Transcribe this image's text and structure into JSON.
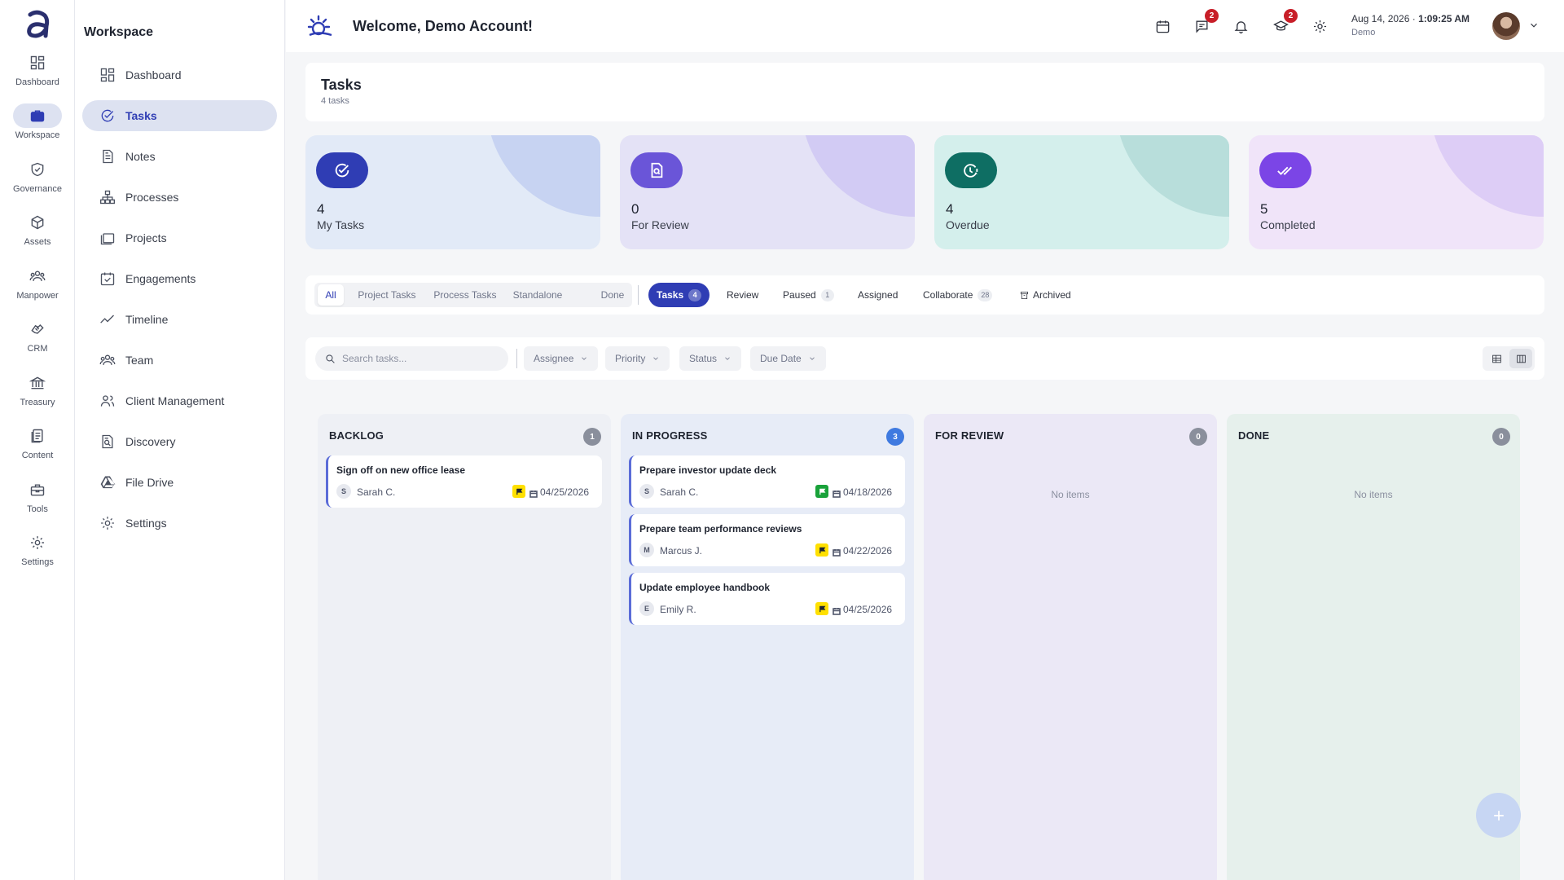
{
  "rail": {
    "items": [
      {
        "label": "Dashboard",
        "icon": "dashboard-icon"
      },
      {
        "label": "Workspace",
        "icon": "briefcase-icon",
        "active": true
      },
      {
        "label": "Governance",
        "icon": "shield-check-icon"
      },
      {
        "label": "Assets",
        "icon": "cube-icon"
      },
      {
        "label": "Manpower",
        "icon": "people-icon"
      },
      {
        "label": "CRM",
        "icon": "handshake-icon"
      },
      {
        "label": "Treasury",
        "icon": "bank-icon"
      },
      {
        "label": "Content",
        "icon": "document-icon"
      },
      {
        "label": "Tools",
        "icon": "toolbox-icon"
      },
      {
        "label": "Settings",
        "icon": "gear-icon"
      }
    ]
  },
  "sidebar": {
    "title": "Workspace",
    "items": [
      {
        "label": "Dashboard",
        "icon": "dashboard-icon"
      },
      {
        "label": "Tasks",
        "icon": "check-circle-icon",
        "active": true
      },
      {
        "label": "Notes",
        "icon": "note-icon"
      },
      {
        "label": "Processes",
        "icon": "hierarchy-icon"
      },
      {
        "label": "Projects",
        "icon": "folders-icon"
      },
      {
        "label": "Engagements",
        "icon": "calendar-check-icon"
      },
      {
        "label": "Timeline",
        "icon": "trend-line-icon"
      },
      {
        "label": "Team",
        "icon": "team-icon"
      },
      {
        "label": "Client Management",
        "icon": "client-icon"
      },
      {
        "label": "Discovery",
        "icon": "search-document-icon"
      },
      {
        "label": "File Drive",
        "icon": "drive-icon"
      },
      {
        "label": "Settings",
        "icon": "gear-icon"
      }
    ]
  },
  "header": {
    "welcome": "Welcome, Demo Account!",
    "date": "Aug 14, 2026",
    "time": "1:09:25 AM",
    "user": "Demo",
    "chat_badge": "2",
    "school_badge": "2"
  },
  "page": {
    "title": "Tasks",
    "subtitle": "4 tasks"
  },
  "stats": [
    {
      "value": "4",
      "label": "My Tasks",
      "bg": "#e2eaf7",
      "blob": "#c7d3f2",
      "icon_bg": "#2f3db4"
    },
    {
      "value": "0",
      "label": "For Review",
      "bg": "#e4e2f6",
      "blob": "#d2cbf4",
      "icon_bg": "#6a55d8"
    },
    {
      "value": "4",
      "label": "Overdue",
      "bg": "#d4efec",
      "blob": "#b8dedb",
      "icon_bg": "#0e6e63"
    },
    {
      "value": "5",
      "label": "Completed",
      "bg": "#f0e4f9",
      "blob": "#ddcdf6",
      "icon_bg": "#7b45e6"
    }
  ],
  "scope_tabs": [
    "All",
    "Project Tasks",
    "Process Tasks",
    "Standalone",
    "Done"
  ],
  "type_tabs": [
    {
      "label": "Tasks",
      "count": "4"
    },
    {
      "label": "Review"
    },
    {
      "label": "Paused",
      "count": "1"
    },
    {
      "label": "Assigned"
    },
    {
      "label": "Collaborate",
      "count": "28"
    },
    {
      "label": "Archived"
    }
  ],
  "filters": {
    "search_placeholder": "Search tasks...",
    "assignee": "Assignee",
    "priority": "Priority",
    "status": "Status",
    "due_date": "Due Date"
  },
  "columns": [
    {
      "title": "BACKLOG",
      "count": "1",
      "bg": "#eef0f5",
      "count_bg": "#8a8f9c",
      "cards": [
        {
          "title": "Sign off on new office lease",
          "initial": "S",
          "assignee": "Sarah C.",
          "flag": "#ffe000",
          "date": "04/25/2026"
        }
      ]
    },
    {
      "title": "IN PROGRESS",
      "count": "3",
      "bg": "#e7ecf7",
      "count_bg": "#3f7ae0",
      "cards": [
        {
          "title": "Prepare investor update deck",
          "initial": "S",
          "assignee": "Sarah C.",
          "flag": "#19a23a",
          "date": "04/18/2026"
        },
        {
          "title": "Prepare team performance reviews",
          "initial": "M",
          "assignee": "Marcus J.",
          "flag": "#ffe000",
          "date": "04/22/2026"
        },
        {
          "title": "Update employee handbook",
          "initial": "E",
          "assignee": "Emily R.",
          "flag": "#ffe000",
          "date": "04/25/2026"
        }
      ]
    },
    {
      "title": "FOR REVIEW",
      "count": "0",
      "bg": "#ebe8f6",
      "count_bg": "#8a8f9c",
      "empty": "No items",
      "cards": []
    },
    {
      "title": "DONE",
      "count": "0",
      "bg": "#e6f0ec",
      "count_bg": "#8a8f9c",
      "empty": "No items",
      "cards": []
    }
  ]
}
